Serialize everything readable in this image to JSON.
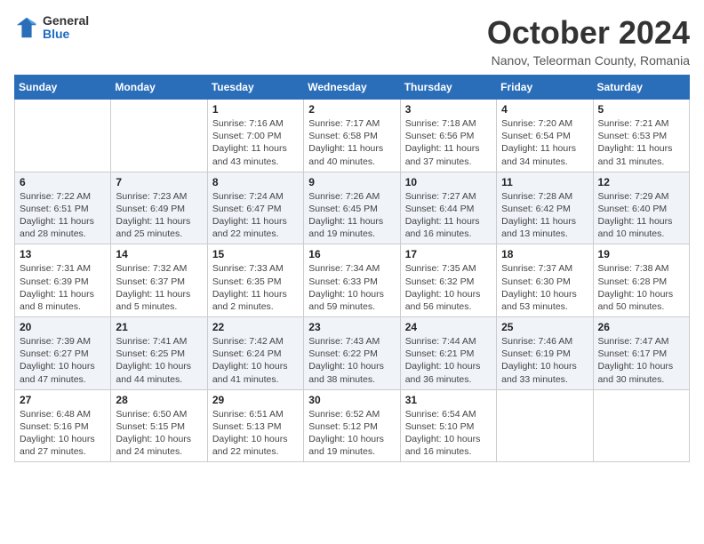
{
  "logo": {
    "general": "General",
    "blue": "Blue"
  },
  "title": "October 2024",
  "location": "Nanov, Teleorman County, Romania",
  "weekdays": [
    "Sunday",
    "Monday",
    "Tuesday",
    "Wednesday",
    "Thursday",
    "Friday",
    "Saturday"
  ],
  "weeks": [
    [
      null,
      null,
      {
        "day": 1,
        "sunrise": "7:16 AM",
        "sunset": "7:00 PM",
        "daylight": "11 hours and 43 minutes."
      },
      {
        "day": 2,
        "sunrise": "7:17 AM",
        "sunset": "6:58 PM",
        "daylight": "11 hours and 40 minutes."
      },
      {
        "day": 3,
        "sunrise": "7:18 AM",
        "sunset": "6:56 PM",
        "daylight": "11 hours and 37 minutes."
      },
      {
        "day": 4,
        "sunrise": "7:20 AM",
        "sunset": "6:54 PM",
        "daylight": "11 hours and 34 minutes."
      },
      {
        "day": 5,
        "sunrise": "7:21 AM",
        "sunset": "6:53 PM",
        "daylight": "11 hours and 31 minutes."
      }
    ],
    [
      {
        "day": 6,
        "sunrise": "7:22 AM",
        "sunset": "6:51 PM",
        "daylight": "11 hours and 28 minutes."
      },
      {
        "day": 7,
        "sunrise": "7:23 AM",
        "sunset": "6:49 PM",
        "daylight": "11 hours and 25 minutes."
      },
      {
        "day": 8,
        "sunrise": "7:24 AM",
        "sunset": "6:47 PM",
        "daylight": "11 hours and 22 minutes."
      },
      {
        "day": 9,
        "sunrise": "7:26 AM",
        "sunset": "6:45 PM",
        "daylight": "11 hours and 19 minutes."
      },
      {
        "day": 10,
        "sunrise": "7:27 AM",
        "sunset": "6:44 PM",
        "daylight": "11 hours and 16 minutes."
      },
      {
        "day": 11,
        "sunrise": "7:28 AM",
        "sunset": "6:42 PM",
        "daylight": "11 hours and 13 minutes."
      },
      {
        "day": 12,
        "sunrise": "7:29 AM",
        "sunset": "6:40 PM",
        "daylight": "11 hours and 10 minutes."
      }
    ],
    [
      {
        "day": 13,
        "sunrise": "7:31 AM",
        "sunset": "6:39 PM",
        "daylight": "11 hours and 8 minutes."
      },
      {
        "day": 14,
        "sunrise": "7:32 AM",
        "sunset": "6:37 PM",
        "daylight": "11 hours and 5 minutes."
      },
      {
        "day": 15,
        "sunrise": "7:33 AM",
        "sunset": "6:35 PM",
        "daylight": "11 hours and 2 minutes."
      },
      {
        "day": 16,
        "sunrise": "7:34 AM",
        "sunset": "6:33 PM",
        "daylight": "10 hours and 59 minutes."
      },
      {
        "day": 17,
        "sunrise": "7:35 AM",
        "sunset": "6:32 PM",
        "daylight": "10 hours and 56 minutes."
      },
      {
        "day": 18,
        "sunrise": "7:37 AM",
        "sunset": "6:30 PM",
        "daylight": "10 hours and 53 minutes."
      },
      {
        "day": 19,
        "sunrise": "7:38 AM",
        "sunset": "6:28 PM",
        "daylight": "10 hours and 50 minutes."
      }
    ],
    [
      {
        "day": 20,
        "sunrise": "7:39 AM",
        "sunset": "6:27 PM",
        "daylight": "10 hours and 47 minutes."
      },
      {
        "day": 21,
        "sunrise": "7:41 AM",
        "sunset": "6:25 PM",
        "daylight": "10 hours and 44 minutes."
      },
      {
        "day": 22,
        "sunrise": "7:42 AM",
        "sunset": "6:24 PM",
        "daylight": "10 hours and 41 minutes."
      },
      {
        "day": 23,
        "sunrise": "7:43 AM",
        "sunset": "6:22 PM",
        "daylight": "10 hours and 38 minutes."
      },
      {
        "day": 24,
        "sunrise": "7:44 AM",
        "sunset": "6:21 PM",
        "daylight": "10 hours and 36 minutes."
      },
      {
        "day": 25,
        "sunrise": "7:46 AM",
        "sunset": "6:19 PM",
        "daylight": "10 hours and 33 minutes."
      },
      {
        "day": 26,
        "sunrise": "7:47 AM",
        "sunset": "6:17 PM",
        "daylight": "10 hours and 30 minutes."
      }
    ],
    [
      {
        "day": 27,
        "sunrise": "6:48 AM",
        "sunset": "5:16 PM",
        "daylight": "10 hours and 27 minutes."
      },
      {
        "day": 28,
        "sunrise": "6:50 AM",
        "sunset": "5:15 PM",
        "daylight": "10 hours and 24 minutes."
      },
      {
        "day": 29,
        "sunrise": "6:51 AM",
        "sunset": "5:13 PM",
        "daylight": "10 hours and 22 minutes."
      },
      {
        "day": 30,
        "sunrise": "6:52 AM",
        "sunset": "5:12 PM",
        "daylight": "10 hours and 19 minutes."
      },
      {
        "day": 31,
        "sunrise": "6:54 AM",
        "sunset": "5:10 PM",
        "daylight": "10 hours and 16 minutes."
      },
      null,
      null
    ]
  ]
}
